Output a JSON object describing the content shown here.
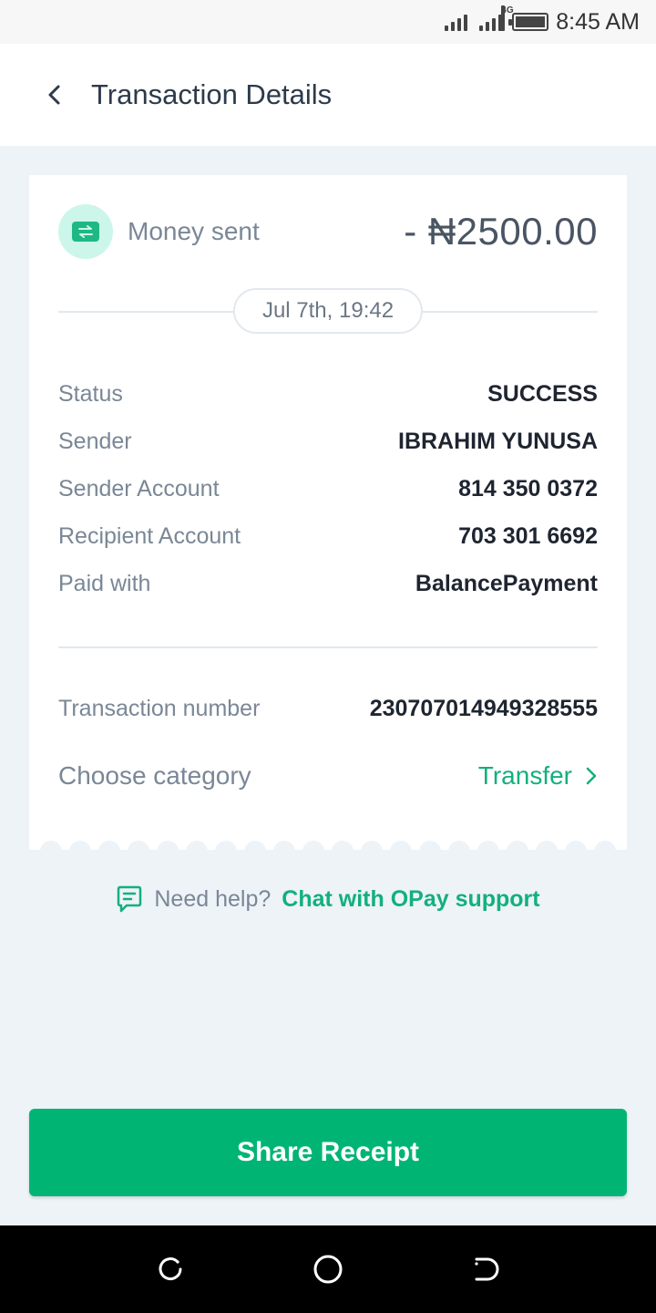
{
  "status_bar": {
    "network_label": "4G",
    "time": "8:45 AM"
  },
  "header": {
    "title": "Transaction Details"
  },
  "summary": {
    "label": "Money sent",
    "amount": "- ₦2500.00",
    "date": "Jul 7th, 19:42"
  },
  "details": [
    {
      "key": "Status",
      "value": "SUCCESS"
    },
    {
      "key": "Sender",
      "value": "IBRAHIM YUNUSA"
    },
    {
      "key": "Sender Account",
      "value": "814 350 0372"
    },
    {
      "key": "Recipient Account",
      "value": "703 301 6692"
    },
    {
      "key": "Paid with",
      "value": "BalancePayment"
    }
  ],
  "transaction_number": {
    "key": "Transaction number",
    "value": "230707014949328555"
  },
  "category": {
    "key": "Choose category",
    "value": "Transfer"
  },
  "help": {
    "question": "Need help?",
    "link": "Chat with OPay support"
  },
  "share_button": {
    "label": "Share Receipt"
  },
  "colors": {
    "accent": "#00b574",
    "link": "#12b07d",
    "background": "#eef3f8",
    "icon_bg": "#cdf6ea"
  },
  "icons": [
    "signal-icon",
    "battery-icon",
    "back-arrow-icon",
    "transfer-icon",
    "chevron-right-icon",
    "chat-icon",
    "recent-apps-icon",
    "home-icon",
    "back-icon"
  ]
}
